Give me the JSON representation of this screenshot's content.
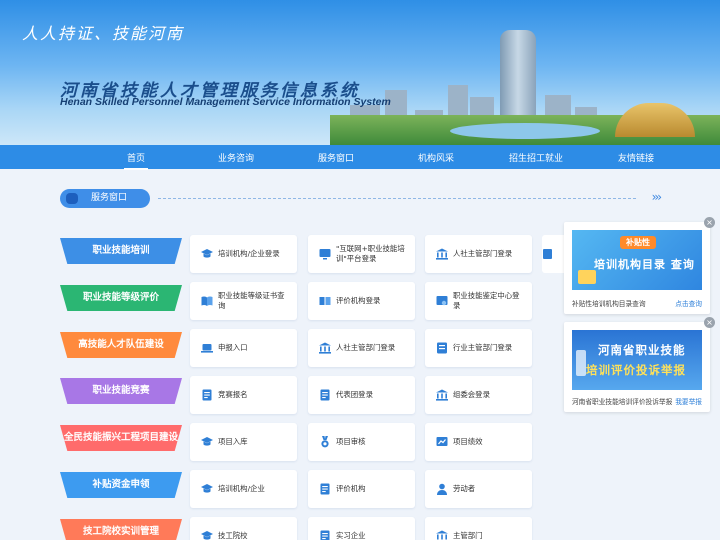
{
  "banner": {
    "slogan": "人人持证、技能河南",
    "title_cn": "河南省技能人才管理服务信息系统",
    "title_en": "Henan Skilled Personnel Management Service Information System"
  },
  "nav": {
    "items": [
      "首页",
      "业务咨询",
      "服务窗口",
      "机构风采",
      "招生招工就业",
      "友情链接"
    ],
    "active": "首页"
  },
  "section": {
    "title": "服务窗口",
    "arrows": "›››"
  },
  "categories": [
    {
      "label": "职业技能培训",
      "color": "#3d8fe6"
    },
    {
      "label": "职业技能等级评价",
      "color": "#2bb673"
    },
    {
      "label": "高技能人才队伍建设",
      "color": "#ff8a3d"
    },
    {
      "label": "职业技能竞赛",
      "color": "#a877e6"
    },
    {
      "label": "全民技能振兴工程项目建设",
      "color": "#ff6b6b"
    },
    {
      "label": "补贴资金申领",
      "color": "#3d9bf0"
    },
    {
      "label": "技工院校实训管理",
      "color": "#ff7a59"
    }
  ],
  "rows": [
    [
      "培训机构/企业登录",
      "\"互联网+职业技能培训\"平台登录",
      "人社主管部门登录"
    ],
    [
      "职业技能等级证书查询",
      "评价机构登录",
      "职业技能鉴定中心登录"
    ],
    [
      "申报入口",
      "人社主管部门登录",
      "行业主管部门登录"
    ],
    [
      "竞赛报名",
      "代表团登录",
      "组委会登录"
    ],
    [
      "项目入库",
      "项目审核",
      "项目绩效"
    ],
    [
      "培训机构/企业",
      "评价机构",
      "劳动者"
    ],
    [
      "技工院校",
      "实习企业",
      "主管部门"
    ]
  ],
  "icons": [
    [
      "graduation-cap-icon",
      "monitor-icon",
      "government-building-icon"
    ],
    [
      "book-icon",
      "open-book-icon",
      "certificate-icon"
    ],
    [
      "laptop-icon",
      "government-building-icon",
      "id-card-icon"
    ],
    [
      "document-icon",
      "document-icon",
      "government-building-icon"
    ],
    [
      "graduation-cap-icon",
      "medal-icon",
      "chart-icon"
    ],
    [
      "graduation-cap-icon",
      "document-icon",
      "person-icon"
    ],
    [
      "graduation-cap-icon",
      "document-icon",
      "government-building-icon"
    ]
  ],
  "ads": [
    {
      "badge": "补贴性",
      "title": "培训机构目录 查询",
      "caption": "补贴性培训机构目录查询",
      "link": "点击查询"
    },
    {
      "title_line1": "河南省职业技能",
      "title_line2": "培训评价投诉举报",
      "caption": "河南省职业技能培训评价投诉举报",
      "link": "我要举报"
    }
  ],
  "close_symbol": "×",
  "colors": {
    "primary": "#2d8ce6",
    "icon": "#2f7fd6"
  }
}
